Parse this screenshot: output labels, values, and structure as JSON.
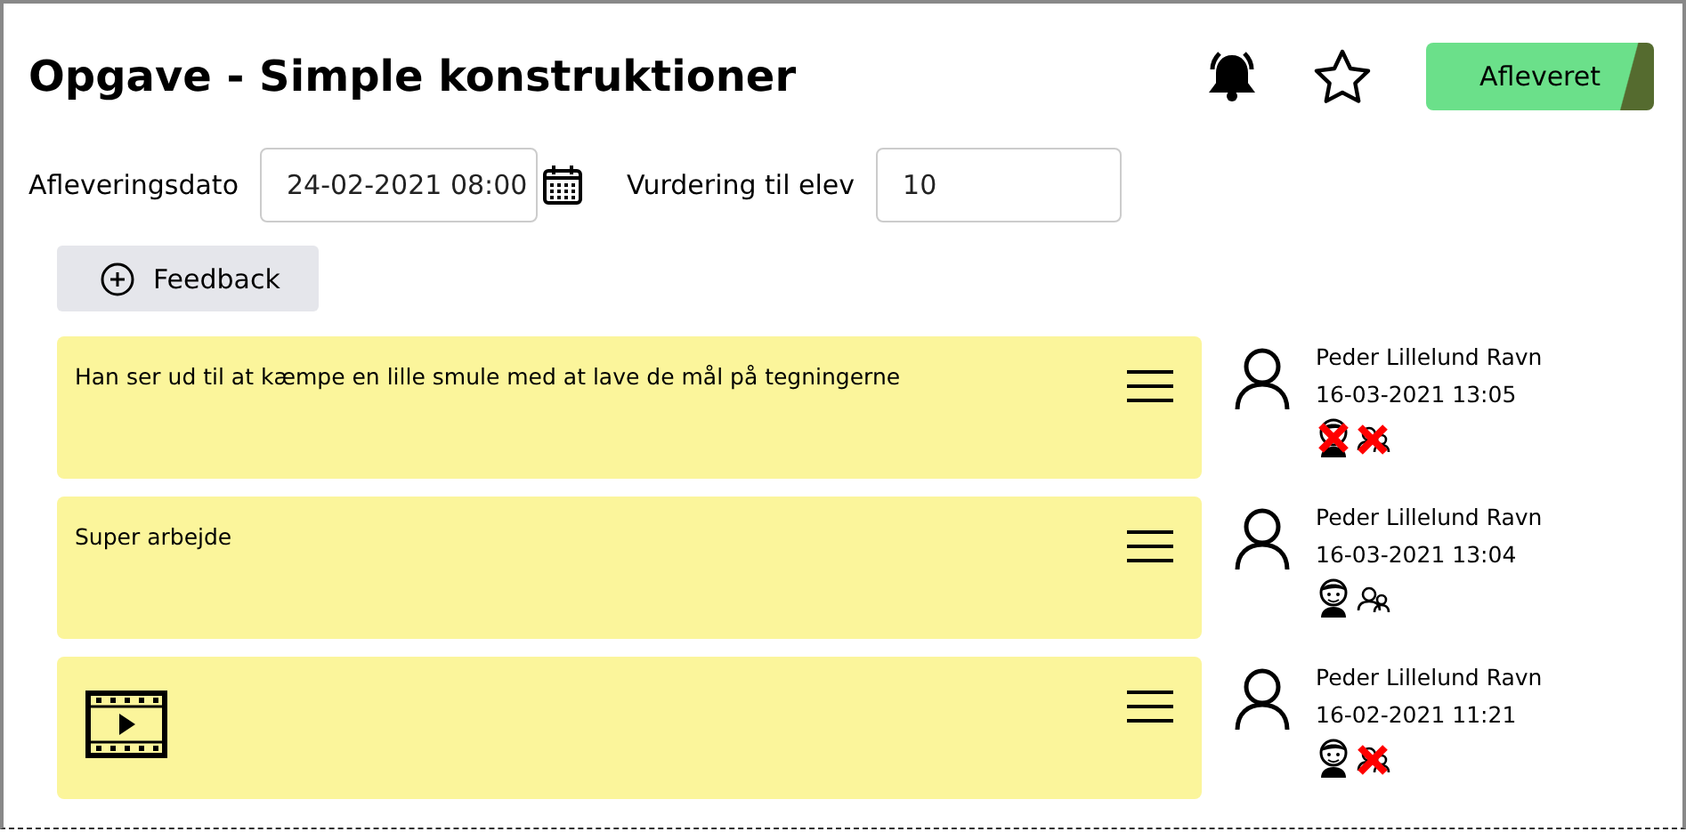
{
  "title": "Opgave - Simple konstruktioner",
  "header": {
    "notifications_on": true,
    "favorite": false,
    "status_button": "Afleveret"
  },
  "fields": [
    {
      "label": "Afleveringsdato",
      "value": "24-02-2021 08:00",
      "kind": "date"
    },
    {
      "label": "Vurdering til elev",
      "value": "10",
      "kind": "text"
    }
  ],
  "feedback_button": "Feedback",
  "feedback": [
    {
      "kind": "text",
      "text": "Han ser ud til at kæmpe en lille smule med at lave de mål på tegningerne",
      "author": "Peder Lillelund Ravn",
      "date": "16-03-2021 13:05",
      "visible_to_student": false,
      "visible_to_parents": false
    },
    {
      "kind": "text",
      "text": "Super arbejde",
      "author": "Peder Lillelund Ravn",
      "date": "16-03-2021 13:04",
      "visible_to_student": true,
      "visible_to_parents": true
    },
    {
      "kind": "video",
      "author": "Peder Lillelund Ravn",
      "date": "16-02-2021 11:21",
      "visible_to_student": true,
      "visible_to_parents": false
    }
  ]
}
